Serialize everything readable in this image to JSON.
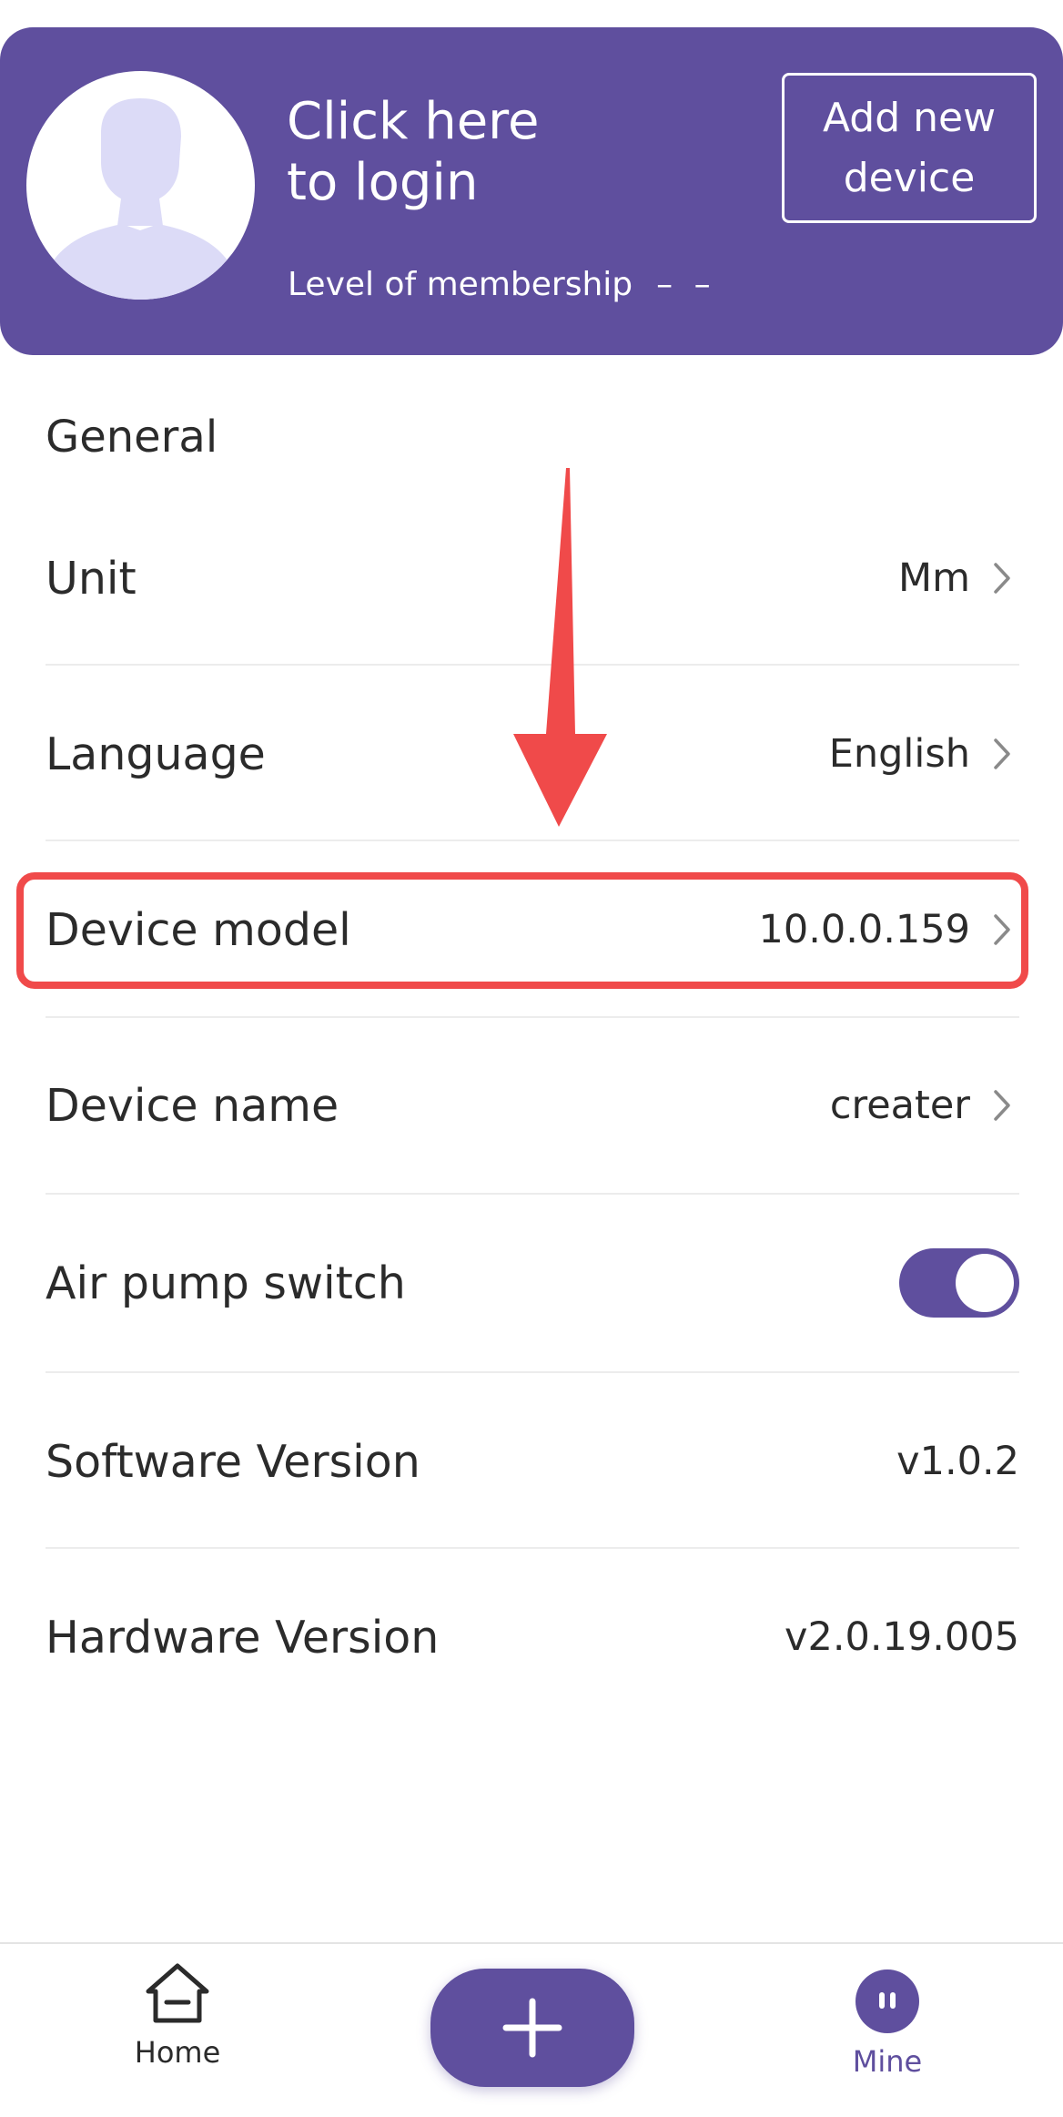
{
  "header": {
    "login_line1": "Click here",
    "login_line2": "to login",
    "membership_label": "Level of membership",
    "membership_value": "– –",
    "add_device_label": "Add new device"
  },
  "settings": {
    "section_title": "General",
    "unit": {
      "label": "Unit",
      "value": "Mm"
    },
    "language": {
      "label": "Language",
      "value": "English"
    },
    "device_model": {
      "label": "Device model",
      "value": "10.0.0.159"
    },
    "device_name": {
      "label": "Device name",
      "value": "creater"
    },
    "air_pump": {
      "label": "Air pump switch",
      "enabled": true
    },
    "software_version": {
      "label": "Software Version",
      "value": "v1.0.2"
    },
    "hardware_version": {
      "label": "Hardware Version",
      "value": "v2.0.19.005"
    }
  },
  "nav": {
    "home_label": "Home",
    "mine_label": "Mine",
    "active_tab": "Mine"
  },
  "colors": {
    "brand_purple": "#5f4f9e",
    "highlight_red": "#f04a4a",
    "avatar_fill": "#dcdbf7"
  },
  "icons": {
    "avatar": "avatar-icon",
    "chevron": "chevron-right-icon",
    "home": "home-icon",
    "add": "plus-icon",
    "mine": "mine-icon"
  }
}
